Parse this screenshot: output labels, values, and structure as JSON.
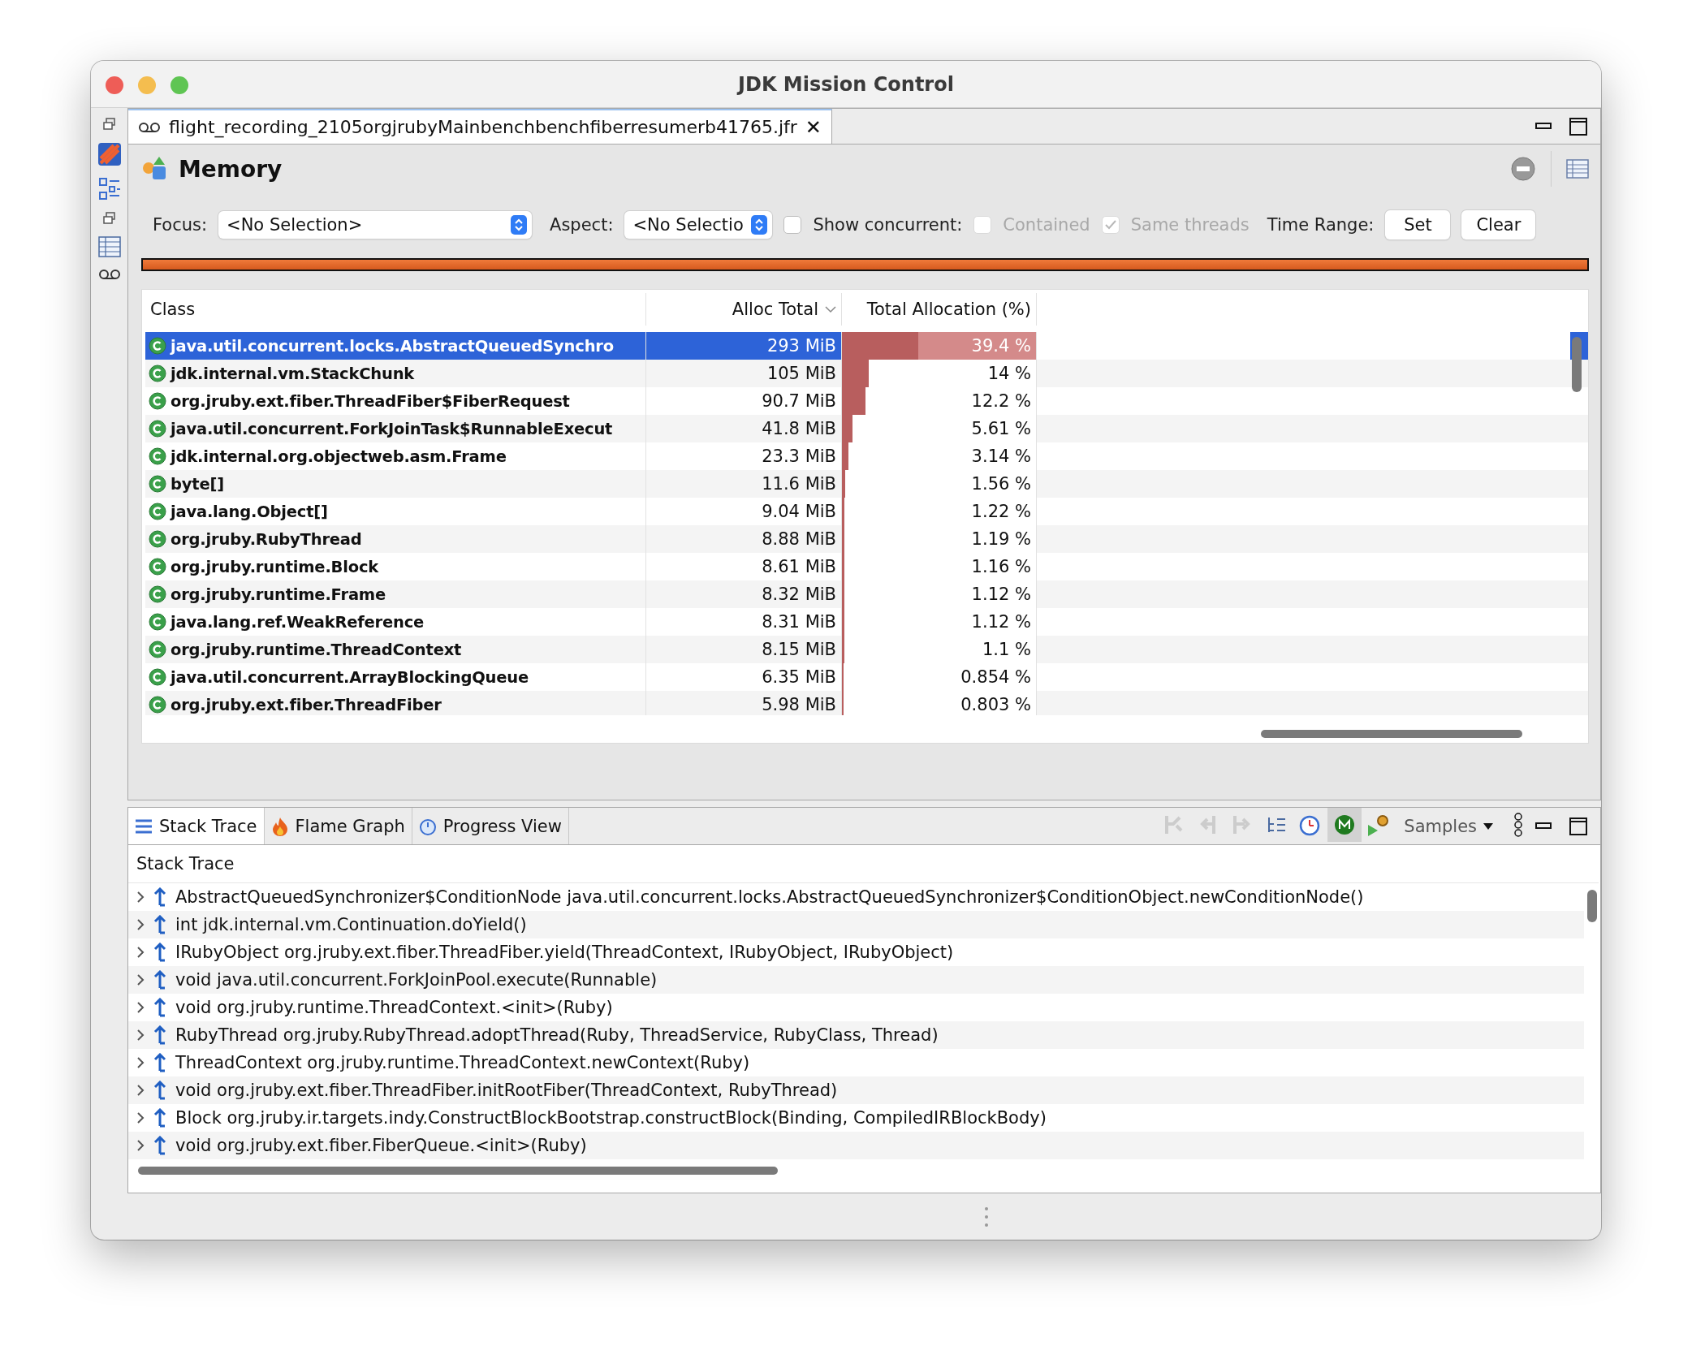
{
  "window": {
    "title": "JDK Mission Control"
  },
  "editor_tab": {
    "label": "flight_recording_2105orgjrubyMainbenchbenchfiberresumerb41765.jfr",
    "close": "✕"
  },
  "page": {
    "title": "Memory"
  },
  "filters": {
    "focus_label": "Focus:",
    "focus_value": "<No Selection>",
    "aspect_label": "Aspect:",
    "aspect_value": "<No Selectio",
    "show_concurrent": {
      "label": "Show concurrent:",
      "checked": false,
      "disabled": false
    },
    "contained": {
      "label": "Contained",
      "checked": false,
      "disabled": true
    },
    "same_threads": {
      "label": "Same threads",
      "checked": true,
      "disabled": true
    },
    "time_range_label": "Time Range:",
    "buttons": [
      "Set",
      "Clear"
    ]
  },
  "table": {
    "columns": [
      "Class",
      "Alloc Total",
      "Total Allocation (%)"
    ],
    "rows": [
      {
        "class": "java.util.concurrent.locks.AbstractQueuedSynchro",
        "alloc": "293 MiB",
        "percent": "39.4 %",
        "level": 0.394,
        "selected": true
      },
      {
        "class": "jdk.internal.vm.StackChunk",
        "alloc": "105 MiB",
        "percent": "14 %",
        "level": 0.14,
        "selected": false
      },
      {
        "class": "org.jruby.ext.fiber.ThreadFiber$FiberRequest",
        "alloc": "90.7 MiB",
        "percent": "12.2 %",
        "level": 0.122,
        "selected": false
      },
      {
        "class": "java.util.concurrent.ForkJoinTask$RunnableExecut",
        "alloc": "41.8 MiB",
        "percent": "5.61 %",
        "level": 0.0561,
        "selected": false
      },
      {
        "class": "jdk.internal.org.objectweb.asm.Frame",
        "alloc": "23.3 MiB",
        "percent": "3.14 %",
        "level": 0.0314,
        "selected": false
      },
      {
        "class": "byte[]",
        "alloc": "11.6 MiB",
        "percent": "1.56 %",
        "level": 0.0156,
        "selected": false
      },
      {
        "class": "java.lang.Object[]",
        "alloc": "9.04 MiB",
        "percent": "1.22 %",
        "level": 0.0122,
        "selected": false
      },
      {
        "class": "org.jruby.RubyThread",
        "alloc": "8.88 MiB",
        "percent": "1.19 %",
        "level": 0.0119,
        "selected": false
      },
      {
        "class": "org.jruby.runtime.Block",
        "alloc": "8.61 MiB",
        "percent": "1.16 %",
        "level": 0.0116,
        "selected": false
      },
      {
        "class": "org.jruby.runtime.Frame",
        "alloc": "8.32 MiB",
        "percent": "1.12 %",
        "level": 0.0112,
        "selected": false
      },
      {
        "class": "java.lang.ref.WeakReference",
        "alloc": "8.31 MiB",
        "percent": "1.12 %",
        "level": 0.0112,
        "selected": false
      },
      {
        "class": "org.jruby.runtime.ThreadContext",
        "alloc": "8.15 MiB",
        "percent": "1.1 %",
        "level": 0.011,
        "selected": false
      },
      {
        "class": "java.util.concurrent.ArrayBlockingQueue",
        "alloc": "6.35 MiB",
        "percent": "0.854 %",
        "level": 0.00854,
        "selected": false
      },
      {
        "class": "org.jruby.ext.fiber.ThreadFiber",
        "alloc": "5.98 MiB",
        "percent": "0.803 %",
        "level": 0.00803,
        "selected": false
      }
    ]
  },
  "bottom_tabs": [
    {
      "label": "Stack Trace",
      "kind": "list",
      "selected": true
    },
    {
      "label": "Flame Graph",
      "kind": "flame",
      "selected": false
    },
    {
      "label": "Progress View",
      "kind": "progress",
      "selected": false
    }
  ],
  "bottom_toolbar": {
    "samples": "Samples"
  },
  "stack_trace": {
    "title": "Stack Trace",
    "frames": [
      "AbstractQueuedSynchronizer$ConditionNode java.util.concurrent.locks.AbstractQueuedSynchronizer$ConditionObject.newConditionNode()",
      "int jdk.internal.vm.Continuation.doYield()",
      "IRubyObject org.jruby.ext.fiber.ThreadFiber.yield(ThreadContext, IRubyObject, IRubyObject)",
      "void java.util.concurrent.ForkJoinPool.execute(Runnable)",
      "void org.jruby.runtime.ThreadContext.<init>(Ruby)",
      "RubyThread org.jruby.RubyThread.adoptThread(Ruby, ThreadService, RubyClass, Thread)",
      "ThreadContext org.jruby.runtime.ThreadContext.newContext(Ruby)",
      "void org.jruby.ext.fiber.ThreadFiber.initRootFiber(ThreadContext, RubyThread)",
      "Block org.jruby.ir.targets.indy.ConstructBlockBootstrap.constructBlock(Binding, CompiledIRBlockBody)",
      "void org.jruby.ext.fiber.FiberQueue.<init>(Ruby)"
    ]
  }
}
